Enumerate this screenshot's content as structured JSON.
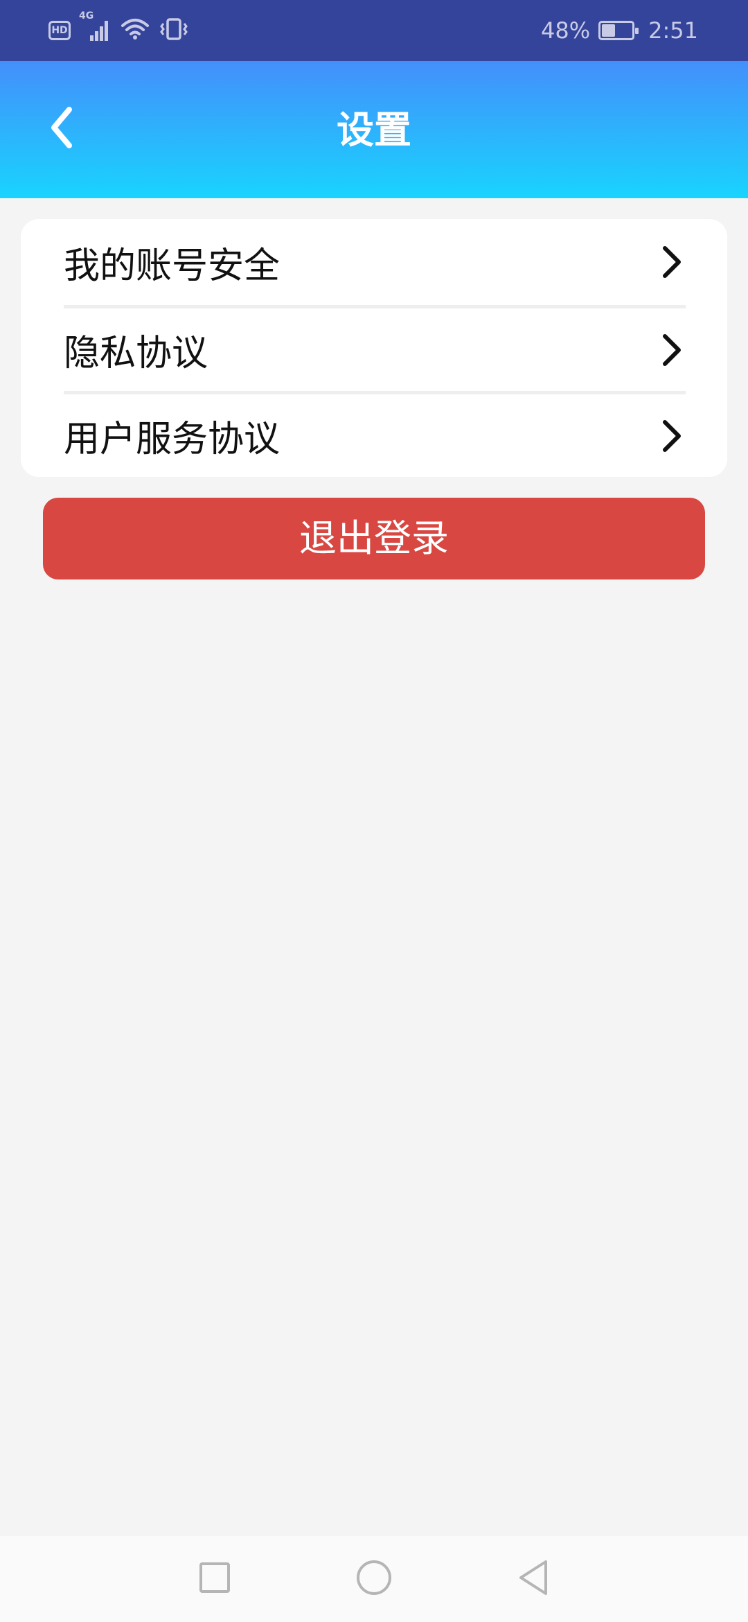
{
  "status_bar": {
    "network_badge": "HD",
    "network_type": "4G",
    "battery_percent": "48%",
    "battery_level": 0.48,
    "time": "2:51"
  },
  "header": {
    "title": "设置",
    "background_gradient": [
      "#448ffb",
      "#18d4fe"
    ]
  },
  "settings": {
    "items": [
      {
        "label": "我的账号安全",
        "icon": "chevron-right-icon"
      },
      {
        "label": "隐私协议",
        "icon": "chevron-right-icon"
      },
      {
        "label": "用户服务协议",
        "icon": "chevron-right-icon"
      }
    ]
  },
  "logout": {
    "label": "退出登录",
    "color": "#d84741"
  },
  "nav_bar": {
    "buttons": [
      "recent-apps",
      "home",
      "back"
    ]
  }
}
